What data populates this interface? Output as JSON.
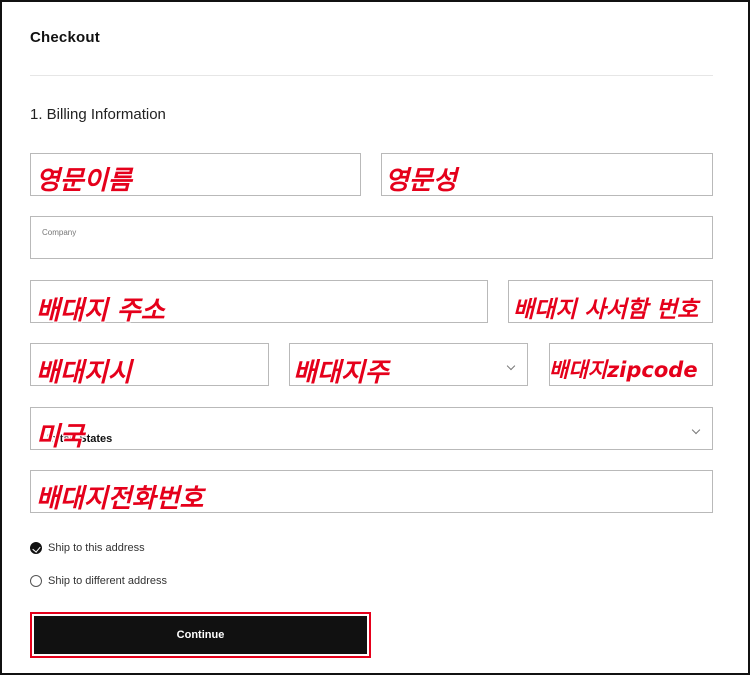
{
  "header": {
    "title": "Checkout"
  },
  "billing": {
    "section_title": "1. Billing Information",
    "first_name": {
      "annotation": "영문이름"
    },
    "last_name": {
      "annotation": "영문성"
    },
    "company": {
      "label": "Company"
    },
    "address": {
      "annotation": "배대지 주소"
    },
    "apt": {
      "annotation": "배대지 사서함 번호"
    },
    "city": {
      "annotation": "배대지시"
    },
    "state": {
      "annotation": "배대지주"
    },
    "zip": {
      "annotation": "배대지zipcode"
    },
    "country": {
      "value": "United States",
      "annotation": "미국"
    },
    "phone": {
      "annotation": "배대지전화번호"
    }
  },
  "shipping_options": [
    {
      "label": "Ship to this address",
      "checked": true
    },
    {
      "label": "Ship to different address",
      "checked": false
    }
  ],
  "continue_label": "Continue",
  "colors": {
    "annotation_red": "#e5001b",
    "button_bg": "#111111"
  }
}
